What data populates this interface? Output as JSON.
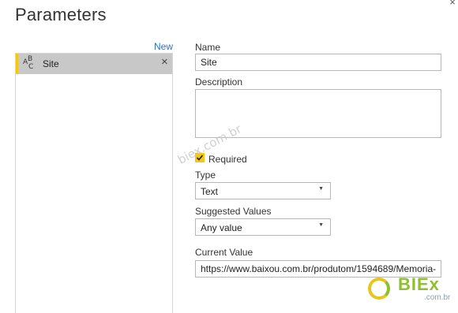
{
  "dialog": {
    "title": "Parameters",
    "close_label": "×"
  },
  "list": {
    "new_label": "New",
    "items": [
      {
        "label": "Site",
        "icon": "abc-text-type-icon",
        "remove_label": "×"
      }
    ]
  },
  "form": {
    "name_label": "Name",
    "name_value": "Site",
    "description_label": "Description",
    "description_value": "",
    "required_label": "Required",
    "required_checked": true,
    "type_label": "Type",
    "type_value": "Text",
    "suggested_label": "Suggested Values",
    "suggested_value": "Any value",
    "current_label": "Current Value",
    "current_value": "https://www.baixou.com.br/produtom/1594689/Memoria-"
  },
  "overlay": {
    "watermark": "biex.com.br",
    "logo_word": "BIEx",
    "logo_sub": ".com.br"
  },
  "colors": {
    "accent": "#f2c811",
    "link": "#2a72c3",
    "selected_bg": "#c8c8c8"
  }
}
